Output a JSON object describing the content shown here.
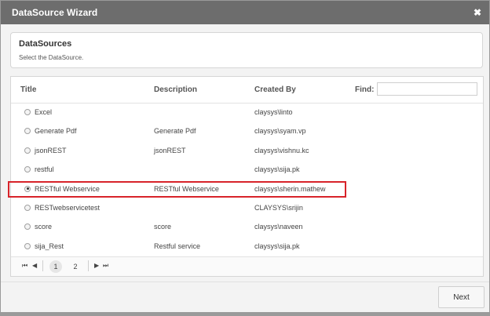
{
  "dialog": {
    "title": "DataSource Wizard",
    "close_glyph": "✖"
  },
  "section": {
    "heading": "DataSources",
    "subtitle": "Select the DataSource."
  },
  "grid": {
    "headers": {
      "title": "Title",
      "description": "Description",
      "created_by": "Created By",
      "find": "Find:"
    },
    "find_value": "",
    "rows": [
      {
        "title": "Excel",
        "description": "",
        "created_by": "claysys\\linto"
      },
      {
        "title": "Generate Pdf",
        "description": "Generate Pdf",
        "created_by": "claysys\\syam.vp"
      },
      {
        "title": "jsonREST",
        "description": "jsonREST",
        "created_by": "claysys\\vishnu.kc"
      },
      {
        "title": "restful",
        "description": "",
        "created_by": "claysys\\sija.pk"
      },
      {
        "title": "RESTful Webservice",
        "description": "RESTful Webservice",
        "created_by": "claysys\\sherin.mathew",
        "selected": true
      },
      {
        "title": "RESTwebservicetest",
        "description": "",
        "created_by": "CLAYSYS\\srijin"
      },
      {
        "title": "score",
        "description": "score",
        "created_by": "claysys\\naveen"
      },
      {
        "title": "sija_Rest",
        "description": "Restful service",
        "created_by": "claysys\\sija.pk"
      }
    ]
  },
  "pager": {
    "first": "⏮",
    "prev": "◀",
    "next": "▶",
    "last": "⏭",
    "pages": [
      "1",
      "2"
    ],
    "current_page": "1"
  },
  "footer": {
    "next_label": "Next"
  }
}
